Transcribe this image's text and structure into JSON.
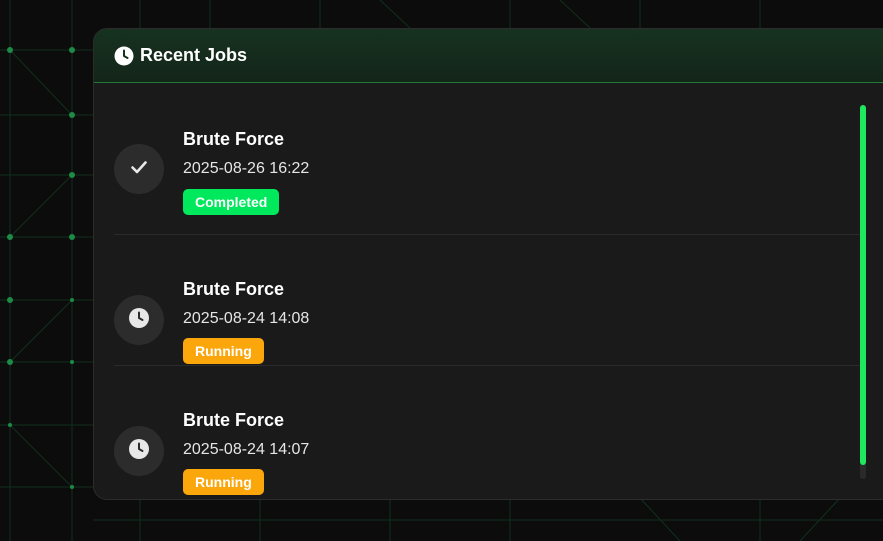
{
  "panel": {
    "title": "Recent Jobs",
    "header_icon": "clock-icon"
  },
  "colors": {
    "completed": "#00e85c",
    "running": "#fba70c",
    "accent": "#1fe860"
  },
  "jobs": [
    {
      "name": "Brute Force",
      "time": "2025-08-26 16:22",
      "status": "Completed",
      "icon": "check-icon"
    },
    {
      "name": "Brute Force",
      "time": "2025-08-24 14:08",
      "status": "Running",
      "icon": "clock-icon"
    },
    {
      "name": "Brute Force",
      "time": "2025-08-24 14:07",
      "status": "Running",
      "icon": "clock-icon"
    }
  ]
}
